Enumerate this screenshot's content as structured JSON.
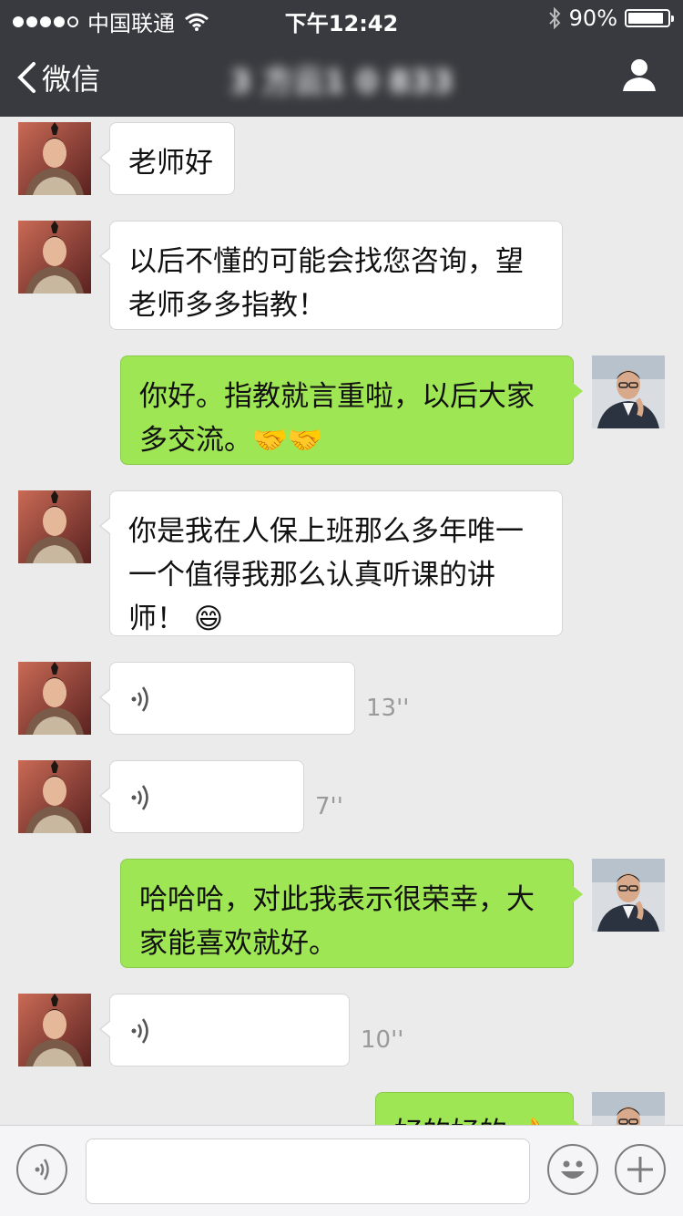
{
  "status_bar": {
    "carrier": "中国联通",
    "time": "下午12:42",
    "battery_percent": 90,
    "battery_text": "90%"
  },
  "nav": {
    "back_label": "微信",
    "title": "3 方云1 0 833"
  },
  "messages": [
    {
      "side": "in",
      "type": "text",
      "text": "老师好"
    },
    {
      "side": "in",
      "type": "text",
      "text": "以后不懂的可能会找您咨询，望老师多多指教！"
    },
    {
      "side": "out",
      "type": "text",
      "text": "你好。指教就言重啦，以后大家多交流。🤝🤝"
    },
    {
      "side": "in",
      "type": "text",
      "text": "你是我在人保上班那么多年唯一一个值得我那么认真听课的讲师！ 😄"
    },
    {
      "side": "in",
      "type": "voice",
      "duration": "13''"
    },
    {
      "side": "in",
      "type": "voice",
      "duration": "7''"
    },
    {
      "side": "out",
      "type": "text",
      "text": "哈哈哈，对此我表示很荣幸，大家能喜欢就好。"
    },
    {
      "side": "in",
      "type": "voice",
      "duration": "10''"
    },
    {
      "side": "out",
      "type": "text",
      "text": "好的好的 👌"
    }
  ],
  "icons": {
    "back": "chevron-left-icon",
    "profile": "person-icon",
    "voice": "voice-wave-icon",
    "emoji": "smiley-icon",
    "more": "plus-icon"
  },
  "colors": {
    "bar": "#393a3f",
    "chat_bg": "#ebebeb",
    "outgoing_bubble": "#9fe655",
    "incoming_bubble": "#ffffff"
  }
}
